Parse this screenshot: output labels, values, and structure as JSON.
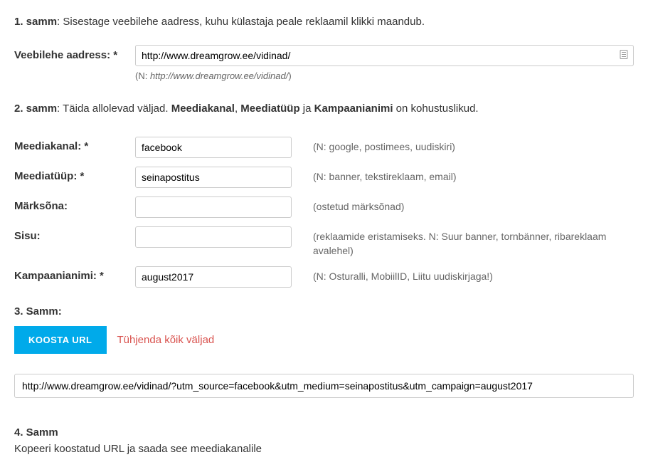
{
  "step1": {
    "boldLabel": "1. samm",
    "text": ": Sisestage veebilehe aadress, kuhu külastaja peale reklaamil klikki maandub."
  },
  "url": {
    "label": "Veebilehe aadress: *",
    "value": "http://www.dreamgrow.ee/vidinad/",
    "hintPrefix": "(N: ",
    "hintUrl": "http://www.dreamgrow.ee/vidinad/",
    "hintSuffix": ")"
  },
  "step2": {
    "boldLabel": "2. samm",
    "textA": ": Täida allolevad väljad. ",
    "bold1": "Meediakanal",
    "sep1": ", ",
    "bold2": "Meediatüüp",
    "sep2": " ja ",
    "bold3": "Kampaanianimi",
    "textB": " on kohustuslikud."
  },
  "fields": {
    "meediakanal": {
      "label": "Meediakanal: *",
      "value": "facebook",
      "hint": "(N: google, postimees, uudiskiri)"
    },
    "meediatuup": {
      "label": "Meediatüüp: *",
      "value": "seinapostitus",
      "hint": "(N: banner, tekstireklaam, email)"
    },
    "marksona": {
      "label": "Märksõna:",
      "value": "",
      "hint": "(ostetud märksõnad)"
    },
    "sisu": {
      "label": "Sisu:",
      "value": "",
      "hint": "(reklaamide eristamiseks. N: Suur banner, tornbänner, ribareklaam avalehel)"
    },
    "kampaanianimi": {
      "label": "Kampaanianimi: *",
      "value": "august2017",
      "hint": "(N: Osturalli, MobiilID, Liitu uudiskirjaga!)"
    }
  },
  "step3": {
    "heading": "3. Samm:",
    "buttonLabel": "KOOSTA URL",
    "clearLabel": "Tühjenda kõik väljad"
  },
  "result": {
    "value": "http://www.dreamgrow.ee/vidinad/?utm_source=facebook&utm_medium=seinapostitus&utm_campaign=august2017"
  },
  "step4": {
    "heading": "4. Samm",
    "text": "Kopeeri koostatud URL ja saada see meediakanalile"
  }
}
